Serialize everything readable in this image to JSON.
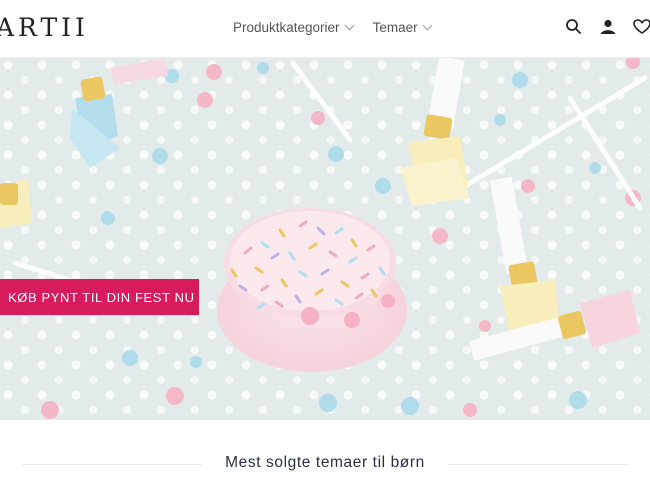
{
  "header": {
    "logo": "ARTII",
    "nav": [
      {
        "label": "Produktkategorier"
      },
      {
        "label": "Temaer"
      }
    ],
    "icons": [
      "search-icon",
      "user-icon",
      "heart-icon"
    ]
  },
  "hero": {
    "cta_label": "KØB PYNT TIL DIN FEST NU"
  },
  "section": {
    "title": "Mest solgte temaer til børn"
  },
  "colors": {
    "accent": "#d81b5c",
    "hero_bg": "#dfe9e6",
    "heading": "#2a2f45"
  }
}
